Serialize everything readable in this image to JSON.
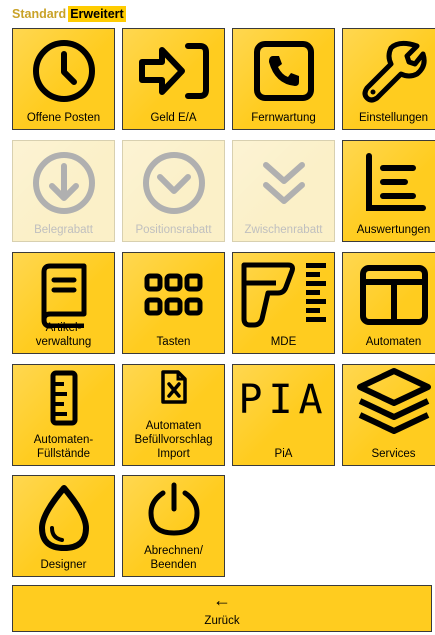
{
  "tabs": [
    {
      "label": "Standard",
      "active": false
    },
    {
      "label": "Erweitert",
      "active": true
    }
  ],
  "tiles": [
    {
      "label": "Offene Posten",
      "icon": "clock-icon",
      "enabled": true
    },
    {
      "label": "Geld E/A",
      "icon": "sign-in-arrow-icon",
      "enabled": true
    },
    {
      "label": "Fernwartung",
      "icon": "phone-icon",
      "enabled": true
    },
    {
      "label": "Einstellungen",
      "icon": "wrench-icon",
      "enabled": true
    },
    {
      "label": "Belegrabatt",
      "icon": "arrow-down-circle-icon",
      "enabled": false
    },
    {
      "label": "Positionsrabatt",
      "icon": "chevron-down-circle-icon",
      "enabled": false
    },
    {
      "label": "Zwischenrabatt",
      "icon": "double-chevron-down-icon",
      "enabled": false
    },
    {
      "label": "Auswertungen",
      "icon": "chart-icon",
      "enabled": true
    },
    {
      "label": "Artikel-\nverwaltung",
      "icon": "book-icon",
      "enabled": true
    },
    {
      "label": "Tasten",
      "icon": "keypad-icon",
      "enabled": true
    },
    {
      "label": "MDE",
      "icon": "barcode-scanner-icon",
      "enabled": true
    },
    {
      "label": "Automaten",
      "icon": "columns-icon",
      "enabled": true
    },
    {
      "label": "Automaten-\nFüllstände",
      "icon": "ruler-icon",
      "enabled": true
    },
    {
      "label": "Automaten\nBefüllvorschlag\nImport",
      "icon": "excel-file-icon",
      "enabled": true
    },
    {
      "label": "PiA",
      "icon": "pia-text-icon",
      "icon_text": "PIA",
      "enabled": true
    },
    {
      "label": "Services",
      "icon": "layers-icon",
      "enabled": true
    },
    {
      "label": "Designer",
      "icon": "drop-icon",
      "enabled": true
    },
    {
      "label": "Abrechnen/\nBeenden",
      "icon": "power-icon",
      "enabled": true
    }
  ],
  "back_button": {
    "label": "Zurück",
    "arrow": "←",
    "icon": "arrow-left-icon"
  },
  "colors": {
    "tile": "#ffcc1f",
    "tile_disabled": "#fbf0c8",
    "icon_disabled": "#b0b0b0",
    "tab_active": "#ffcc00",
    "tab_inactive_text": "#c9a227"
  }
}
